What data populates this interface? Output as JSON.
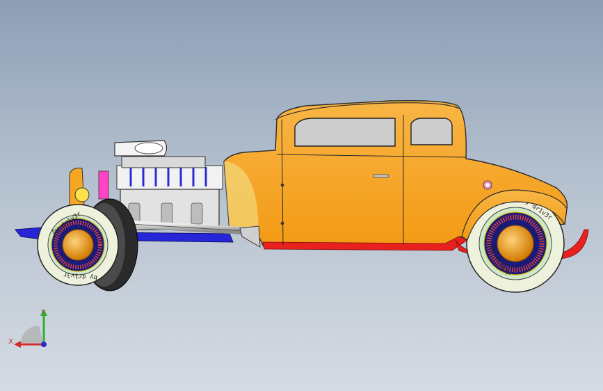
{
  "scene": {
    "background_top": "#8d9fb6",
    "background_bottom": "#d5dbe3",
    "body_color": "#f5a623",
    "frame_color": "#2b2bd6",
    "exhaust_color": "#e8201e",
    "tire_color": "#eef2dc",
    "tire_text": "by dr1v3r"
  },
  "triad": {
    "x_label": "X",
    "y_label": "Y",
    "x_color": "#d42b2b",
    "y_color": "#2fae2f",
    "z_color": "#2b2bd6"
  }
}
